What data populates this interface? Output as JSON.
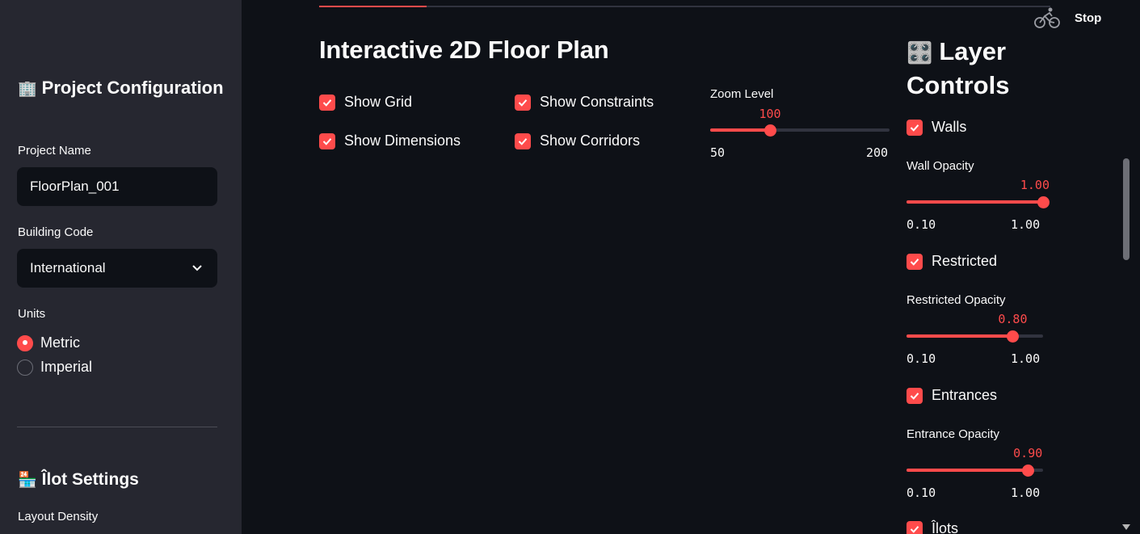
{
  "sidebar": {
    "project_config_title": "Project Configuration",
    "project_config_icon": "office-building-icon",
    "project_name_label": "Project Name",
    "project_name_value": "FloorPlan_001",
    "building_code_label": "Building Code",
    "building_code_value": "International",
    "units_label": "Units",
    "units_options": [
      "Metric",
      "Imperial"
    ],
    "units_selected": "Metric",
    "ilot_settings_title": "Îlot Settings",
    "ilot_settings_icon": "store-icon",
    "layout_density_label": "Layout Density"
  },
  "header": {
    "running_progress": 0.147,
    "stop_label": "Stop",
    "running_icon": "cyclist-icon"
  },
  "main": {
    "title": "Interactive 2D Floor Plan",
    "checkboxes": {
      "show_grid": "Show Grid",
      "show_dimensions": "Show Dimensions",
      "show_constraints": "Show Constraints",
      "show_corridors": "Show Corridors"
    },
    "zoom": {
      "label": "Zoom Level",
      "value": "100",
      "min": "50",
      "max": "200",
      "value_num": 100,
      "min_num": 50,
      "max_num": 200
    }
  },
  "layers": {
    "title": "Layer Controls",
    "icon": "control-knobs-icon",
    "walls": {
      "label": "Walls",
      "opacity_label": "Wall Opacity",
      "value": "1.00",
      "min": "0.10",
      "max": "1.00",
      "value_num": 1.0
    },
    "restricted": {
      "label": "Restricted",
      "opacity_label": "Restricted Opacity",
      "value": "0.80",
      "min": "0.10",
      "max": "1.00",
      "value_num": 0.8
    },
    "entrances": {
      "label": "Entrances",
      "opacity_label": "Entrance Opacity",
      "value": "0.90",
      "min": "0.10",
      "max": "1.00",
      "value_num": 0.9
    },
    "ilots": {
      "label": "Îlots"
    }
  },
  "colors": {
    "accent": "#ff4b4b",
    "background": "#0e1117",
    "sidebar": "#262730"
  }
}
